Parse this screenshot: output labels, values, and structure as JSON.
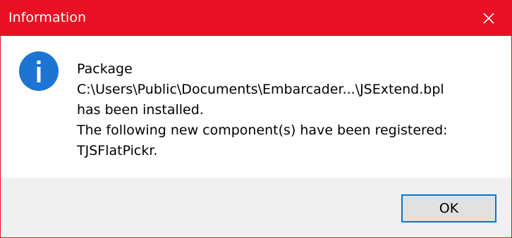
{
  "window": {
    "title": "Information",
    "close_icon": "close-icon",
    "accent_color": "#e81123"
  },
  "message": {
    "icon": "info-icon",
    "lines": [
      "Package",
      "C:\\Users\\Public\\Documents\\Embarcader...\\JSExtend.bpl",
      "has been installed.",
      "The following new component(s) have been registered:",
      "TJSFlatPickr."
    ]
  },
  "buttons": {
    "ok_label": "OK"
  }
}
